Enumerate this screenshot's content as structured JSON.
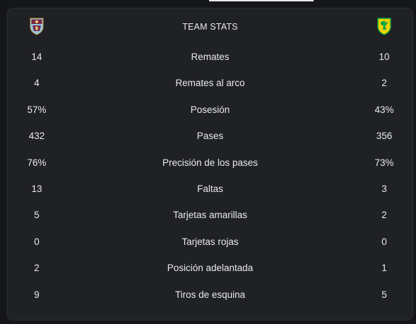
{
  "header": {
    "title": "TEAM STATS",
    "home_crest_icon": "burnley-crest-icon",
    "away_crest_icon": "norwich-crest-icon"
  },
  "stats": [
    {
      "label": "Remates",
      "home": "14",
      "away": "10"
    },
    {
      "label": "Remates al arco",
      "home": "4",
      "away": "2"
    },
    {
      "label": "Posesión",
      "home": "57%",
      "away": "43%"
    },
    {
      "label": "Pases",
      "home": "432",
      "away": "356"
    },
    {
      "label": "Precisión de los pases",
      "home": "76%",
      "away": "73%"
    },
    {
      "label": "Faltas",
      "home": "13",
      "away": "3"
    },
    {
      "label": "Tarjetas amarillas",
      "home": "5",
      "away": "2"
    },
    {
      "label": "Tarjetas rojas",
      "home": "0",
      "away": "0"
    },
    {
      "label": "Posición adelantada",
      "home": "2",
      "away": "1"
    },
    {
      "label": "Tiros de esquina",
      "home": "9",
      "away": "5"
    }
  ],
  "colors": {
    "background": "#151619",
    "card": "#202124",
    "text": "#e8eaed",
    "burnley_claret": "#7a2a45",
    "burnley_blue": "#8fc6e8",
    "norwich_yellow": "#f2d300",
    "norwich_green": "#00a14b"
  }
}
